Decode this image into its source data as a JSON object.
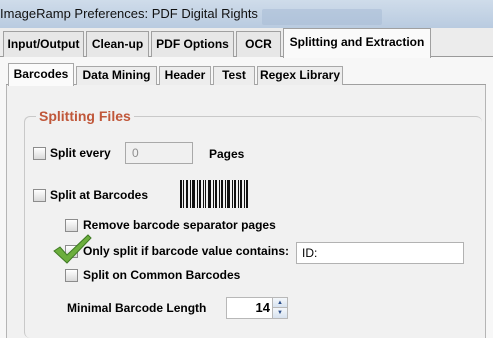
{
  "window": {
    "title": "ImageRamp Preferences:  PDF Digital Rights"
  },
  "main_tabs": [
    {
      "label": "Input/Output"
    },
    {
      "label": "Clean-up"
    },
    {
      "label": "PDF Options"
    },
    {
      "label": "OCR"
    },
    {
      "label": "Splitting and Extraction"
    }
  ],
  "active_main_tab": "Splitting and Extraction",
  "sub_tabs": [
    {
      "label": "Barcodes"
    },
    {
      "label": "Data Mining"
    },
    {
      "label": "Header"
    },
    {
      "label": "Test"
    },
    {
      "label": "Regex Library"
    }
  ],
  "active_sub_tab": "Barcodes",
  "splitting": {
    "group_title": "Splitting Files",
    "split_every": {
      "label": "Split every",
      "value": "0",
      "unit": "Pages",
      "checked": false
    },
    "split_at_barcodes": {
      "label": "Split at Barcodes",
      "checked": false
    },
    "remove_separator": {
      "label": "Remove barcode separator pages",
      "checked": false
    },
    "only_split_if": {
      "label": "Only split if barcode value contains:",
      "value": "ID:",
      "checked": true
    },
    "common_barcodes": {
      "label": "Split on Common Barcodes",
      "checked": false
    },
    "min_length": {
      "label": "Minimal Barcode Length",
      "value": "14"
    }
  },
  "colors": {
    "group_title": "#c0573a",
    "checkmark": "#6cae3d",
    "spinner_arrow": "#2b4e8a"
  }
}
